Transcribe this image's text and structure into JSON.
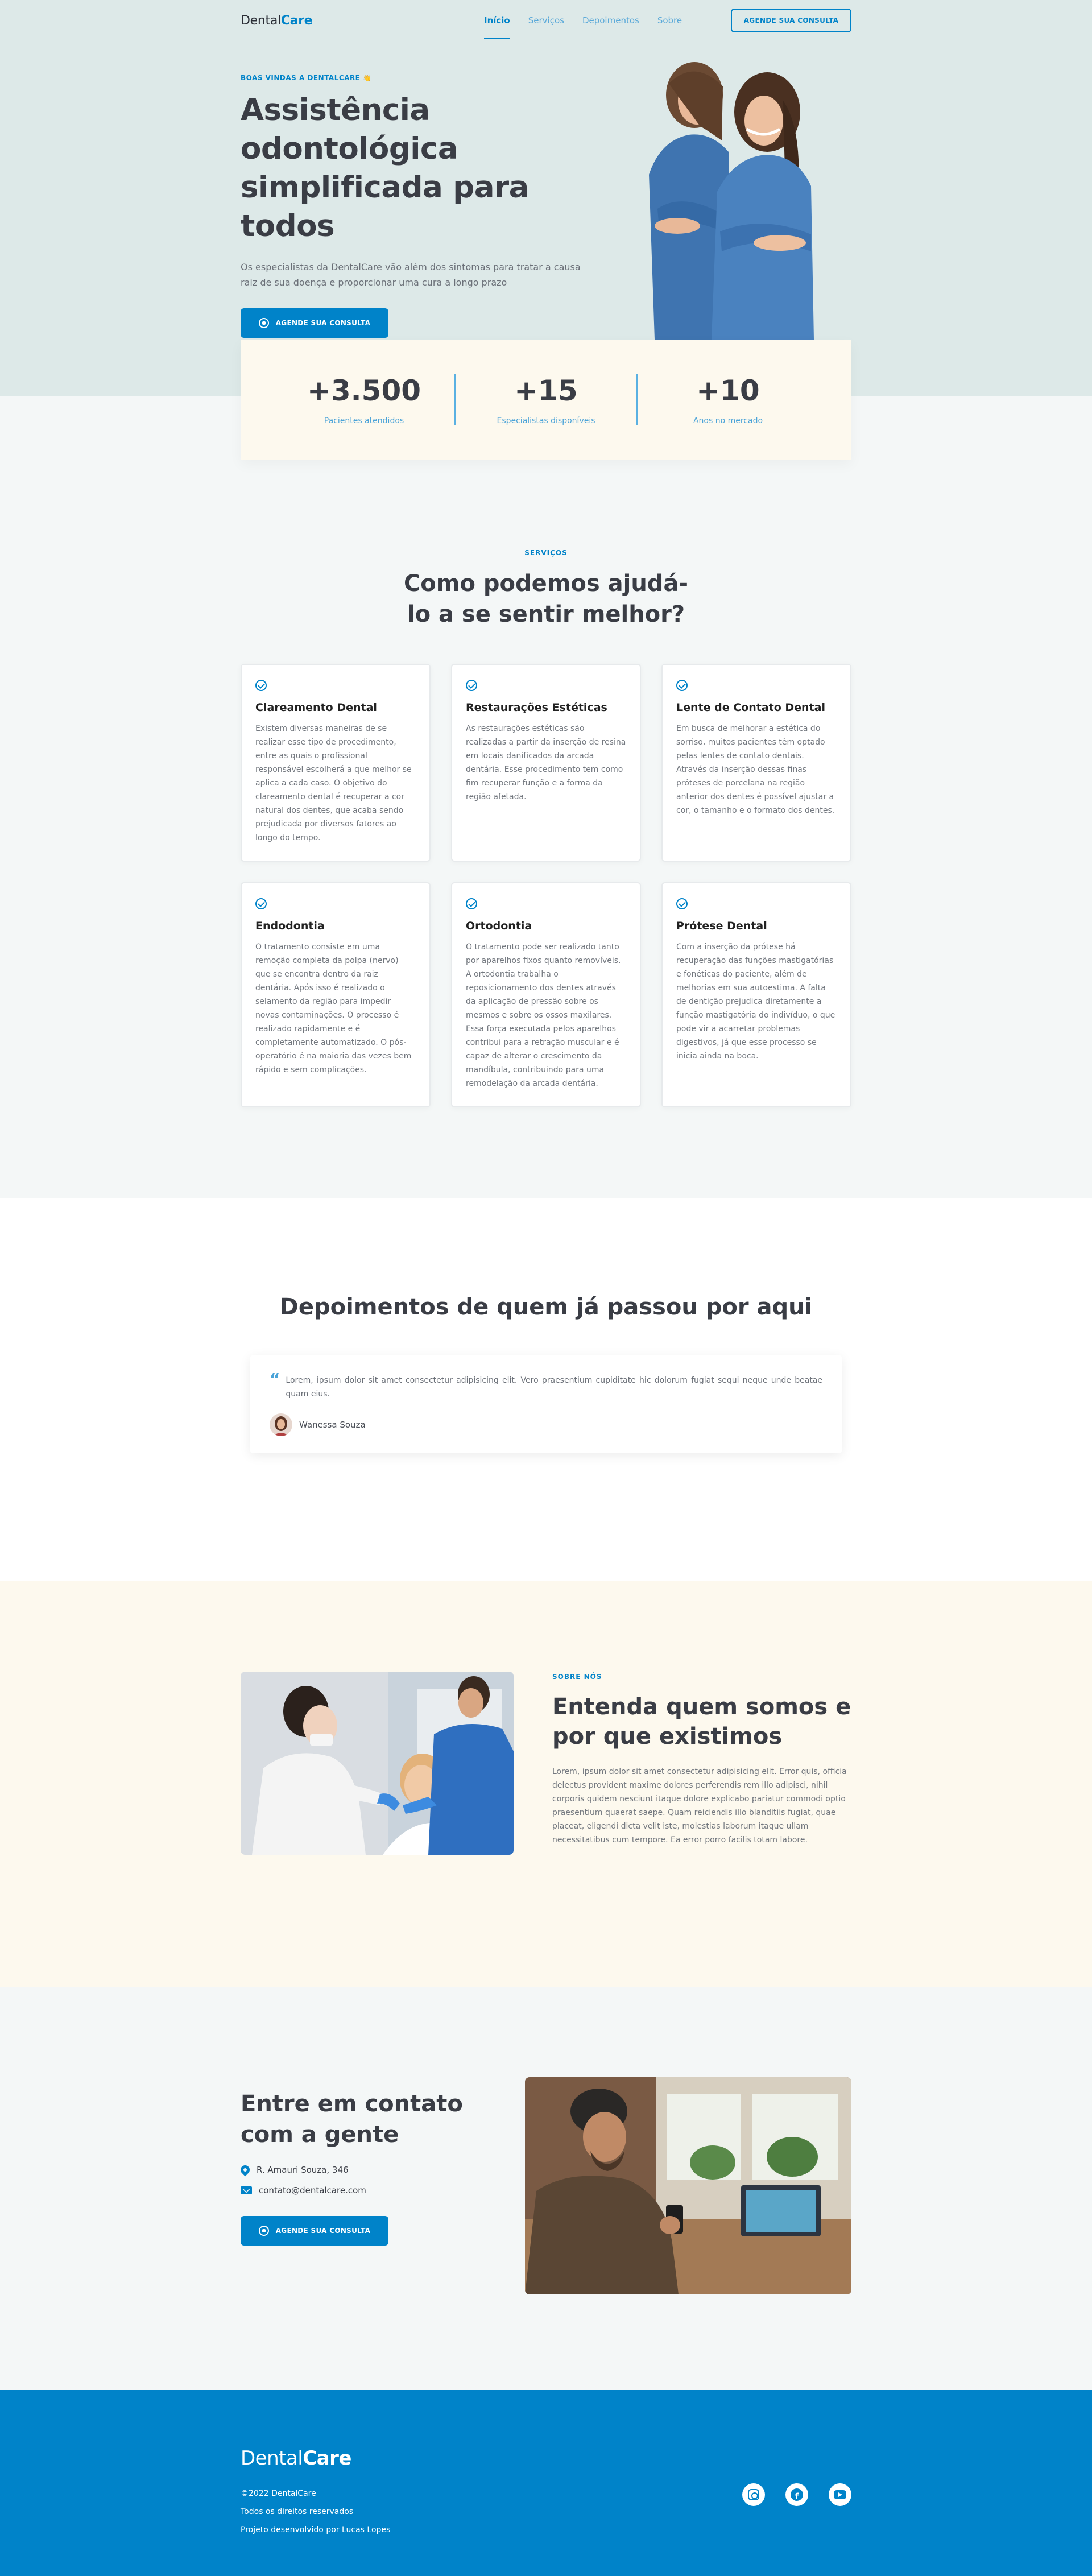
{
  "header": {
    "logo_part1": "Dental",
    "logo_part2": "Care",
    "nav": [
      "Início",
      "Serviços",
      "Depoimentos",
      "Sobre"
    ],
    "cta": "AGENDE SUA CONSULTA"
  },
  "hero": {
    "eyebrow": "BOAS VINDAS A DENTALCARE 👋",
    "title": "Assistência odontológica simplificada para todos",
    "subtitle": "Os especialistas da DentalCare vão além dos sintomas para tratar a causa raiz de sua doença e proporcionar uma cura a longo prazo",
    "cta": "AGENDE SUA CONSULTA"
  },
  "stats": [
    {
      "value": "+3.500",
      "label": "Pacientes atendidos"
    },
    {
      "value": "+15",
      "label": "Especialistas disponíveis"
    },
    {
      "value": "+10",
      "label": "Anos no mercado"
    }
  ],
  "services": {
    "eyebrow": "SERVIÇOS",
    "title_line1": "Como podemos ajudá-",
    "title_line2": "lo a se sentir melhor?",
    "cards": [
      {
        "title": "Clareamento Dental",
        "text": "Existem diversas maneiras de se realizar esse tipo de procedimento, entre as quais o profissional responsável escolherá a que melhor se aplica a cada caso. O objetivo do clareamento dental é recuperar a cor natural dos dentes, que acaba sendo prejudicada por diversos fatores ao longo do tempo."
      },
      {
        "title": "Restaurações Estéticas",
        "text": "As restaurações estéticas são realizadas a partir da inserção de resina em locais danificados da arcada dentária. Esse procedimento tem como fim recuperar função e a forma da região afetada."
      },
      {
        "title": "Lente de Contato Dental",
        "text": "Em busca de melhorar a estética do sorriso, muitos pacientes têm optado pelas lentes de contato dentais. Através da inserção dessas finas próteses de porcelana na região anterior dos dentes é possível ajustar a cor, o tamanho e o formato dos dentes."
      },
      {
        "title": "Endodontia",
        "text": "O tratamento consiste em uma remoção completa da polpa (nervo) que se encontra dentro da raiz dentária. Após isso é realizado o selamento da região para impedir novas contaminações. O processo é realizado rapidamente e é completamente automatizado. O pós-operatório é na maioria das vezes bem rápido e sem complicações."
      },
      {
        "title": "Ortodontia",
        "text": "O tratamento pode ser realizado tanto por aparelhos fixos quanto removíveis. A ortodontia trabalha o reposicionamento dos dentes através da aplicação de pressão sobre os mesmos e sobre os ossos maxilares. Essa força executada pelos aparelhos contribui para a retração muscular e é capaz de alterar o crescimento da mandíbula, contribuindo para uma remodelação da arcada dentária."
      },
      {
        "title": "Prótese Dental",
        "text": "Com a inserção da prótese há recuperação das funções mastigatórias e fonéticas do paciente, além de melhorias em sua autoestima. A falta de dentição prejudica diretamente a função mastigatória do indivíduo, o que pode vir a acarretar problemas digestivos, já que esse processo se inicia ainda na boca."
      }
    ]
  },
  "testimonials": {
    "title": "Depoimentos de quem já passou por aqui",
    "quote": "Lorem, ipsum dolor sit amet consectetur adipisicing elit. Vero praesentium cupiditate hic dolorum fugiat sequi neque unde beatae quam eius.",
    "author": "Wanessa Souza"
  },
  "about": {
    "eyebrow": "SOBRE NÓS",
    "title": "Entenda quem somos e por que existimos",
    "body": "Lorem, ipsum dolor sit amet consectetur adipisicing elit. Error quis, officia delectus provident maxime dolores perferendis rem illo adipisci, nihil corporis quidem nesciunt itaque dolore explicabo pariatur commodi optio praesentium quaerat saepe. Quam reiciendis illo blanditiis fugiat, quae placeat, eligendi dicta velit iste, molestias laborum itaque ullam necessitatibus cum tempore. Ea error porro facilis totam labore."
  },
  "contact": {
    "title_line1": "Entre em contato",
    "title_line2": "com a gente",
    "address": "R. Amauri Souza, 346",
    "email": "contato@dentalcare.com",
    "cta": "AGENDE SUA CONSULTA"
  },
  "footer": {
    "logo_part1": "Dental",
    "logo_part2": "Care",
    "lines": [
      "©2022 DentalCare",
      "Todos os direitos reservados",
      "Projeto desenvolvido por Lucas Lopes"
    ]
  },
  "colors": {
    "primary": "#0083c9",
    "hero_bg": "#dde9e8",
    "cream": "#fdf9ee",
    "text": "#3a3d45"
  }
}
